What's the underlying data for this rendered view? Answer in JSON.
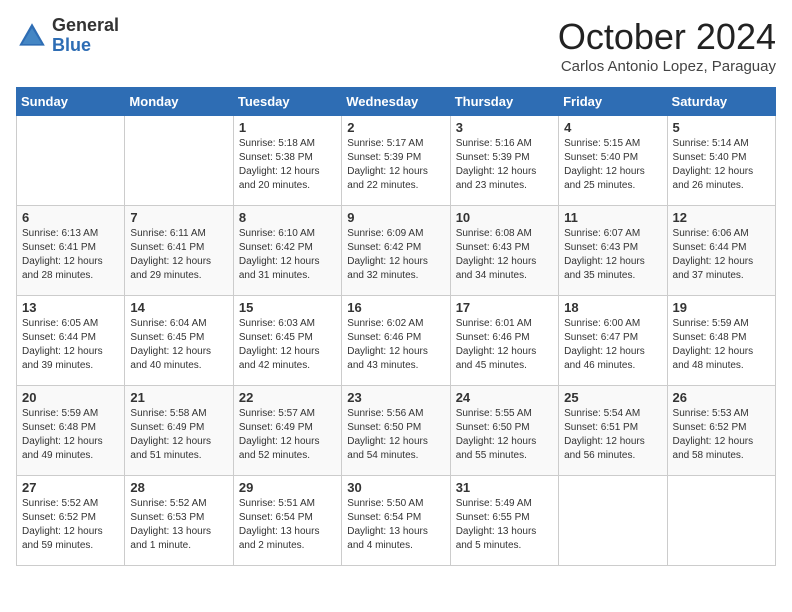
{
  "header": {
    "logo_general": "General",
    "logo_blue": "Blue",
    "title": "October 2024",
    "subtitle": "Carlos Antonio Lopez, Paraguay"
  },
  "days_of_week": [
    "Sunday",
    "Monday",
    "Tuesday",
    "Wednesday",
    "Thursday",
    "Friday",
    "Saturday"
  ],
  "weeks": [
    [
      {
        "day": "",
        "info": ""
      },
      {
        "day": "",
        "info": ""
      },
      {
        "day": "1",
        "info": "Sunrise: 5:18 AM\nSunset: 5:38 PM\nDaylight: 12 hours and 20 minutes."
      },
      {
        "day": "2",
        "info": "Sunrise: 5:17 AM\nSunset: 5:39 PM\nDaylight: 12 hours and 22 minutes."
      },
      {
        "day": "3",
        "info": "Sunrise: 5:16 AM\nSunset: 5:39 PM\nDaylight: 12 hours and 23 minutes."
      },
      {
        "day": "4",
        "info": "Sunrise: 5:15 AM\nSunset: 5:40 PM\nDaylight: 12 hours and 25 minutes."
      },
      {
        "day": "5",
        "info": "Sunrise: 5:14 AM\nSunset: 5:40 PM\nDaylight: 12 hours and 26 minutes."
      }
    ],
    [
      {
        "day": "6",
        "info": "Sunrise: 6:13 AM\nSunset: 6:41 PM\nDaylight: 12 hours and 28 minutes."
      },
      {
        "day": "7",
        "info": "Sunrise: 6:11 AM\nSunset: 6:41 PM\nDaylight: 12 hours and 29 minutes."
      },
      {
        "day": "8",
        "info": "Sunrise: 6:10 AM\nSunset: 6:42 PM\nDaylight: 12 hours and 31 minutes."
      },
      {
        "day": "9",
        "info": "Sunrise: 6:09 AM\nSunset: 6:42 PM\nDaylight: 12 hours and 32 minutes."
      },
      {
        "day": "10",
        "info": "Sunrise: 6:08 AM\nSunset: 6:43 PM\nDaylight: 12 hours and 34 minutes."
      },
      {
        "day": "11",
        "info": "Sunrise: 6:07 AM\nSunset: 6:43 PM\nDaylight: 12 hours and 35 minutes."
      },
      {
        "day": "12",
        "info": "Sunrise: 6:06 AM\nSunset: 6:44 PM\nDaylight: 12 hours and 37 minutes."
      }
    ],
    [
      {
        "day": "13",
        "info": "Sunrise: 6:05 AM\nSunset: 6:44 PM\nDaylight: 12 hours and 39 minutes."
      },
      {
        "day": "14",
        "info": "Sunrise: 6:04 AM\nSunset: 6:45 PM\nDaylight: 12 hours and 40 minutes."
      },
      {
        "day": "15",
        "info": "Sunrise: 6:03 AM\nSunset: 6:45 PM\nDaylight: 12 hours and 42 minutes."
      },
      {
        "day": "16",
        "info": "Sunrise: 6:02 AM\nSunset: 6:46 PM\nDaylight: 12 hours and 43 minutes."
      },
      {
        "day": "17",
        "info": "Sunrise: 6:01 AM\nSunset: 6:46 PM\nDaylight: 12 hours and 45 minutes."
      },
      {
        "day": "18",
        "info": "Sunrise: 6:00 AM\nSunset: 6:47 PM\nDaylight: 12 hours and 46 minutes."
      },
      {
        "day": "19",
        "info": "Sunrise: 5:59 AM\nSunset: 6:48 PM\nDaylight: 12 hours and 48 minutes."
      }
    ],
    [
      {
        "day": "20",
        "info": "Sunrise: 5:59 AM\nSunset: 6:48 PM\nDaylight: 12 hours and 49 minutes."
      },
      {
        "day": "21",
        "info": "Sunrise: 5:58 AM\nSunset: 6:49 PM\nDaylight: 12 hours and 51 minutes."
      },
      {
        "day": "22",
        "info": "Sunrise: 5:57 AM\nSunset: 6:49 PM\nDaylight: 12 hours and 52 minutes."
      },
      {
        "day": "23",
        "info": "Sunrise: 5:56 AM\nSunset: 6:50 PM\nDaylight: 12 hours and 54 minutes."
      },
      {
        "day": "24",
        "info": "Sunrise: 5:55 AM\nSunset: 6:50 PM\nDaylight: 12 hours and 55 minutes."
      },
      {
        "day": "25",
        "info": "Sunrise: 5:54 AM\nSunset: 6:51 PM\nDaylight: 12 hours and 56 minutes."
      },
      {
        "day": "26",
        "info": "Sunrise: 5:53 AM\nSunset: 6:52 PM\nDaylight: 12 hours and 58 minutes."
      }
    ],
    [
      {
        "day": "27",
        "info": "Sunrise: 5:52 AM\nSunset: 6:52 PM\nDaylight: 12 hours and 59 minutes."
      },
      {
        "day": "28",
        "info": "Sunrise: 5:52 AM\nSunset: 6:53 PM\nDaylight: 13 hours and 1 minute."
      },
      {
        "day": "29",
        "info": "Sunrise: 5:51 AM\nSunset: 6:54 PM\nDaylight: 13 hours and 2 minutes."
      },
      {
        "day": "30",
        "info": "Sunrise: 5:50 AM\nSunset: 6:54 PM\nDaylight: 13 hours and 4 minutes."
      },
      {
        "day": "31",
        "info": "Sunrise: 5:49 AM\nSunset: 6:55 PM\nDaylight: 13 hours and 5 minutes."
      },
      {
        "day": "",
        "info": ""
      },
      {
        "day": "",
        "info": ""
      }
    ]
  ]
}
